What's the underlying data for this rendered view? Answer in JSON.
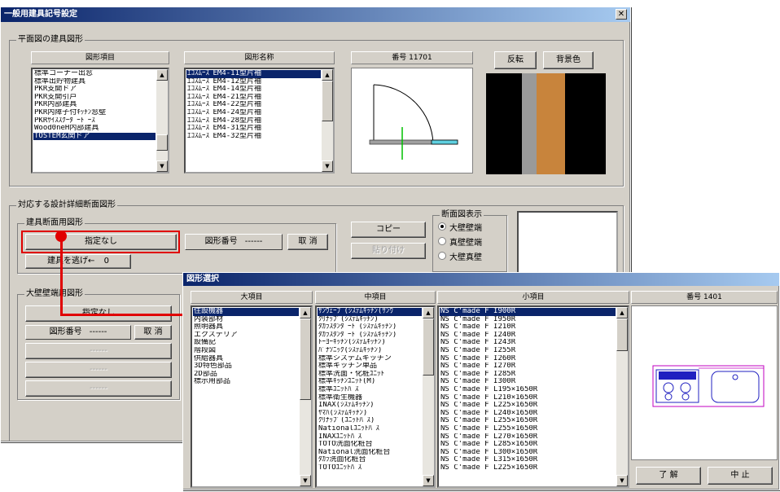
{
  "main_window": {
    "title": "一般用建具記号設定",
    "close_glyph": "✕",
    "section_plan": "平面図の建具図形",
    "col_category": "図形項目",
    "col_figure_name": "図形名称",
    "number_label": "番号 11701",
    "reverse_button": "反転",
    "bg_color_button": "背景色",
    "category_items": [
      {
        "label": "標準コーナー出窓",
        "selected": false
      },
      {
        "label": "標準出貯物建具",
        "selected": false
      },
      {
        "label": "PKR支開ドア",
        "selected": false
      },
      {
        "label": "PKR支開引戸",
        "selected": false
      },
      {
        "label": "PKR内部建具",
        "selected": false
      },
      {
        "label": "PKR内障子付ｷｯﾁﾝ窓壁",
        "selected": false
      },
      {
        "label": "PKRｻｲｽｽｸｰﾀﾞｰﾄﾞｰｽ",
        "selected": false
      },
      {
        "label": "Wood0neH内部建具",
        "selected": false
      },
      {
        "label": "TOSTEM玄関ドア",
        "selected": true
      }
    ],
    "figure_items": [
      {
        "label": "ｴｺｽﾑｰｽﾞEM4-11型片袖",
        "selected": true
      },
      {
        "label": "ｴｺｽﾑｰｽﾞEM4-12型片袖",
        "selected": false
      },
      {
        "label": "ｴｺｽﾑｰｽﾞEM4-14型片袖",
        "selected": false
      },
      {
        "label": "ｴｺｽﾑｰｽﾞEM4-21型片袖",
        "selected": false
      },
      {
        "label": "ｴｺｽﾑｰｽﾞEM4-22型片袖",
        "selected": false
      },
      {
        "label": "ｴｺｽﾑｰｽﾞEM4-24型片袖",
        "selected": false
      },
      {
        "label": "ｴｺｽﾑｰｽﾞEM4-28型片袖",
        "selected": false
      },
      {
        "label": "ｴｺｽﾑｰｽﾞEM4-31型片袖",
        "selected": false
      },
      {
        "label": "ｴｺｽﾑｰｽﾞEM4-32型片袖",
        "selected": false
      }
    ],
    "section_detail": "対応する設計詳細断面図形",
    "section_fitting": "建具断面用図形",
    "unassigned_button": "指定なし",
    "figure_number_label": "図形番号",
    "figure_number_value": "------",
    "cancel_label": "取 消",
    "fitting_offset_label": "建具を逃げ←",
    "fitting_offset_value": "0",
    "copy_button": "コピー",
    "paste_button": "貼り付け",
    "section_display_title": "断面図表示",
    "radio_options": [
      {
        "label": "大壁壁端",
        "checked": true
      },
      {
        "label": "真壁壁端",
        "checked": false
      },
      {
        "label": "大壁真壁",
        "checked": false
      }
    ],
    "section_wall": "大壁壁端用図形",
    "wall_unassigned_button": "指定なし",
    "wall_figure_number_label": "図形番号",
    "wall_figure_number_value": "------",
    "wall_cancel_label": "取 消",
    "placeholder_dashes": "------"
  },
  "sub_window": {
    "title": "図形選択",
    "col_major": "大項目",
    "col_middle": "中項目",
    "col_minor": "小項目",
    "number_label": "番号 1401",
    "ok_button": "了 解",
    "cancel_button": "中 止",
    "major_items": [
      {
        "label": "住設機器",
        "selected": true
      },
      {
        "label": "内装部材",
        "selected": false
      },
      {
        "label": "照明器具",
        "selected": false
      },
      {
        "label": "エクステリア",
        "selected": false
      },
      {
        "label": "設備記",
        "selected": false
      },
      {
        "label": "階段図",
        "selected": false
      },
      {
        "label": "供給器具",
        "selected": false
      },
      {
        "label": "3D特色部品",
        "selected": false
      },
      {
        "label": "2D部品",
        "selected": false
      },
      {
        "label": "標示用部品",
        "selected": false
      }
    ],
    "middle_items": [
      {
        "label": "ｻﾝｳｪｰﾌﾞ(ｼｽﾃﾑｷｯﾁﾝ(ｻﾝｳ",
        "selected": true
      },
      {
        "label": "ｸﾘﾅｯﾌﾟ(ｼｽﾃﾑｷｯﾁﾝ)",
        "selected": false
      },
      {
        "label": "ﾀｶﾗｽﾀﾝﾀﾞｰﾄﾞ(ｼｽﾃﾑｷｯﾁﾝ)",
        "selected": false
      },
      {
        "label": "ﾀｶﾗｽﾀﾝﾀﾞｰﾄﾞ(ｼｽﾃﾑｷｯﾁﾝ)",
        "selected": false
      },
      {
        "label": "ﾄｰﾖｰｷｯﾁﾝ(ｼｽﾃﾑｷｯﾁﾝ)",
        "selected": false
      },
      {
        "label": "ﾊﾟﾅｿﾆｯｸ(ｼｽﾃﾑｷｯﾁﾝ)",
        "selected": false
      },
      {
        "label": "標準システムキッチン",
        "selected": false
      },
      {
        "label": "標準キッチン単品",
        "selected": false
      },
      {
        "label": "標準洗面・化粧ﾕﾆｯﾄ",
        "selected": false
      },
      {
        "label": "標準ｷｯﾁﾝﾕﾆｯﾄ(M)",
        "selected": false
      },
      {
        "label": "標準ﾕﾆｯﾄﾊﾞｽ",
        "selected": false
      },
      {
        "label": "標準衛生機器",
        "selected": false
      },
      {
        "label": "INAX(ｼｽﾃﾑｷｯﾁﾝ)",
        "selected": false
      },
      {
        "label": "ﾔﾏﾊ(ｼｽﾃﾑｷｯﾁﾝ)",
        "selected": false
      },
      {
        "label": "ｸﾘﾅｯﾌﾟ(ﾕﾆｯﾄﾊﾞｽ)",
        "selected": false
      },
      {
        "label": "Nationalﾕﾆｯﾄﾊﾞｽ",
        "selected": false
      },
      {
        "label": "INAXﾕﾆｯﾄﾊﾞｽ",
        "selected": false
      },
      {
        "label": "TOTO洗面化粧台",
        "selected": false
      },
      {
        "label": "National洗面化粧台",
        "selected": false
      },
      {
        "label": "ﾀｶﾗ洗面化粧台",
        "selected": false
      },
      {
        "label": "TOTOﾕﾆｯﾄﾊﾞｽ",
        "selected": false
      }
    ],
    "minor_items": [
      {
        "label": "NS C'made F I900R",
        "selected": true
      },
      {
        "label": "NS C'made F I950R",
        "selected": false
      },
      {
        "label": "NS C'made F I210R",
        "selected": false
      },
      {
        "label": "NS C'made F I240R",
        "selected": false
      },
      {
        "label": "NS C'made F I243R",
        "selected": false
      },
      {
        "label": "NS C'made F I255R",
        "selected": false
      },
      {
        "label": "NS C'made F I260R",
        "selected": false
      },
      {
        "label": "NS C'made F I270R",
        "selected": false
      },
      {
        "label": "NS C'made F I285R",
        "selected": false
      },
      {
        "label": "NS C'made F I300R",
        "selected": false
      },
      {
        "label": "NS C'made F L195×1650R",
        "selected": false
      },
      {
        "label": "NS C'made F L210×1650R",
        "selected": false
      },
      {
        "label": "NS C'made F L225×1650R",
        "selected": false
      },
      {
        "label": "NS C'made F L240×1650R",
        "selected": false
      },
      {
        "label": "NS C'made F L255×1650R",
        "selected": false
      },
      {
        "label": "NS C'made F L255×1650R",
        "selected": false
      },
      {
        "label": "NS C'made F L270×1650R",
        "selected": false
      },
      {
        "label": "NS C'made F L285×1650R",
        "selected": false
      },
      {
        "label": "NS C'made F L300×1650R",
        "selected": false
      },
      {
        "label": "NS C'made F L315×1650R",
        "selected": false
      },
      {
        "label": "NS C'made F L225×1650R",
        "selected": false
      }
    ]
  },
  "colors": {
    "title_blue": "#0a246a",
    "dialog_gray": "#d4d0c8",
    "highlight_red": "#e00000",
    "wood": "#c8843c",
    "door_green": "#00c000",
    "door_cyan": "#5fd0e0",
    "fixture_magenta": "#c000c0",
    "fixture_blue": "#2020c0"
  }
}
